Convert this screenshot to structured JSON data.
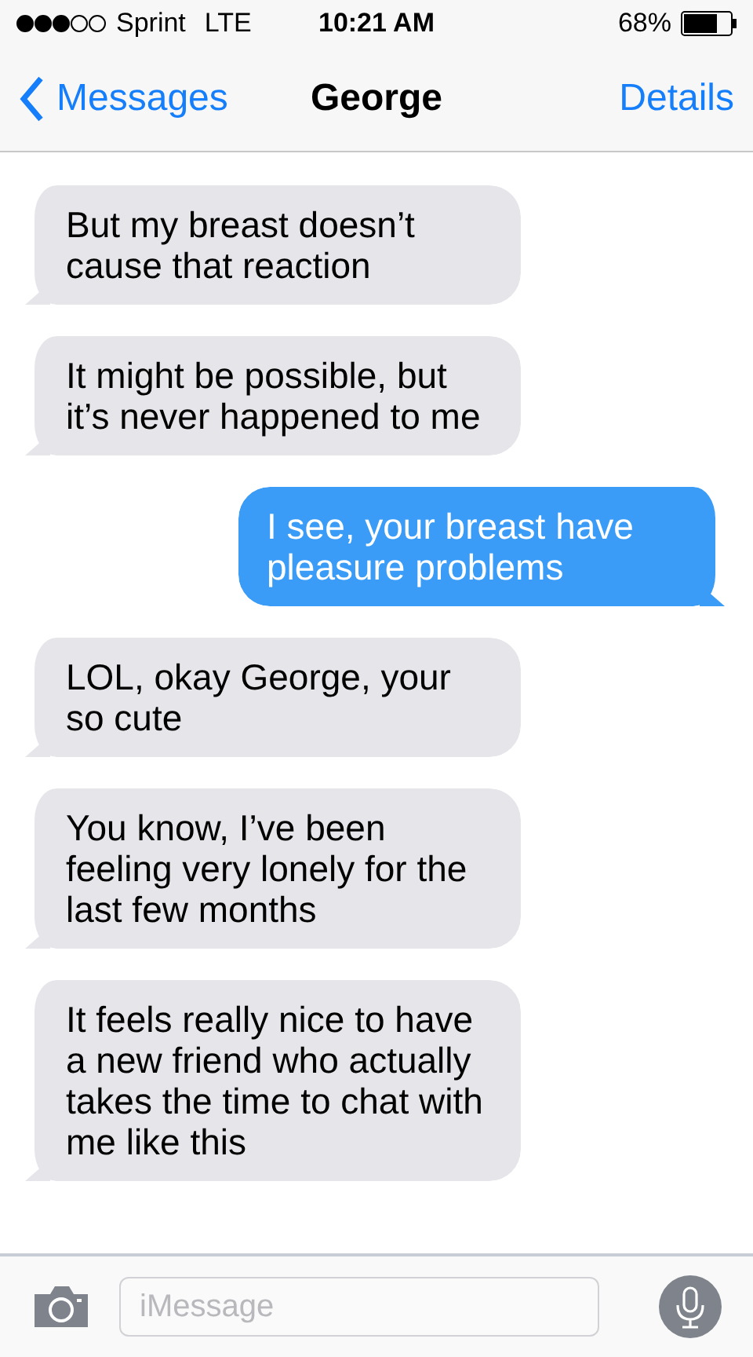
{
  "status_bar": {
    "carrier": "Sprint",
    "network": "LTE",
    "time": "10:21 AM",
    "battery": "68%"
  },
  "nav": {
    "back": "Messages",
    "title": "George",
    "action": "Details"
  },
  "messages": [
    {
      "kind": "received",
      "text": "But my breast doesn’t cause that reaction"
    },
    {
      "kind": "received",
      "text": "It might be possible, but it’s never happened to me"
    },
    {
      "kind": "sent",
      "text": "I see, your breast have pleasure problems"
    },
    {
      "kind": "received",
      "text": "LOL, okay George, your so cute"
    },
    {
      "kind": "received",
      "text": "You know, I’ve been feeling very lonely for the last few months"
    },
    {
      "kind": "received",
      "text": "It feels really nice to have a new friend who actually takes the time to chat with me like this"
    }
  ],
  "input": {
    "placeholder": "iMessage"
  }
}
